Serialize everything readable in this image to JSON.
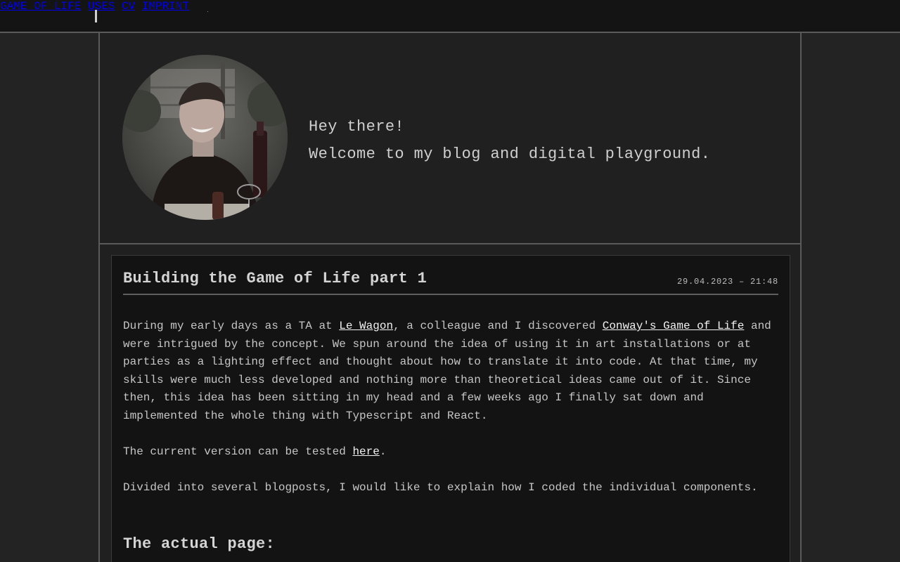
{
  "nav": {
    "items": [
      {
        "label": "GAME OF LIFE"
      },
      {
        "label": "USES"
      },
      {
        "label": "CV"
      },
      {
        "label": "IMPRINT"
      }
    ]
  },
  "hero": {
    "line1": "Hey there!",
    "line2": "Welcome to my blog and digital playground."
  },
  "post": {
    "title": "Building the Game of Life part 1",
    "date": "29.04.2023 – 21:48",
    "p1": {
      "before": "During my early days as a TA at ",
      "link1": "Le Wagon",
      "middle": ", a colleague and I discovered ",
      "link2": "Conway's Game of Life",
      "after": " and were intrigued by the concept. We spun around the idea of using it in art installations or at parties as a lighting effect and thought about how to translate it into code. At that time, my skills were much less developed and nothing more than theoretical ideas came out of it. Since then, this idea has been sitting in my head and a few weeks ago I finally sat down and implemented the whole thing with Typescript and React."
    },
    "p2": {
      "before": "The current version can be tested ",
      "link": "here",
      "after": "."
    },
    "p3": "Divided into several blogposts, I would like to explain how I coded the individual components.",
    "section_title": "The actual page:"
  },
  "colors": {
    "background": "#232323",
    "card": "#131313",
    "border": "#5a5a5a"
  }
}
